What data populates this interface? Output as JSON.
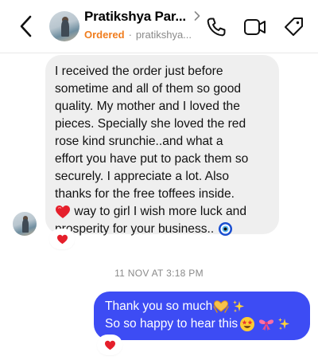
{
  "header": {
    "contact_name": "Pratikshya Par...",
    "status": "Ordered",
    "separator": "·",
    "handle": "pratikshya...",
    "icons": [
      "back-chevron-icon",
      "chevron-right-icon",
      "phone-icon",
      "video-camera-icon",
      "tag-icon"
    ],
    "status_color": "#f07d1e"
  },
  "messages": {
    "incoming": {
      "lines": [
        "I received the order just before",
        "sometime and all of them so good",
        "quality. My mother and I loved the",
        "pieces. Specially she loved the red",
        "rose kind srunchie..and what a",
        "effort you have put to pack them so",
        "securely. I appreciate a lot. Also",
        "thanks for the free toffees inside."
      ],
      "line9_text": " way to girl I wish more luck and",
      "line10_text": "prosperity for your business..",
      "emojis": [
        "red-heart-emoji",
        "evil-eye-emoji"
      ],
      "reaction": "red-heart-emoji",
      "bubble_color": "#efefef"
    },
    "timestamp": "11 NOV AT 3:18 PM",
    "outgoing": {
      "line1_text": "Thank you so much ",
      "line2_text": "So so happy to hear this",
      "emojis": [
        "heart-hands-emoji",
        "sparkles-emoji",
        "star-struck-emoji",
        "ribbon-emoji",
        "sparkles-emoji"
      ],
      "reaction": "red-heart-emoji",
      "bubble_color": "#3d4cf4"
    }
  }
}
